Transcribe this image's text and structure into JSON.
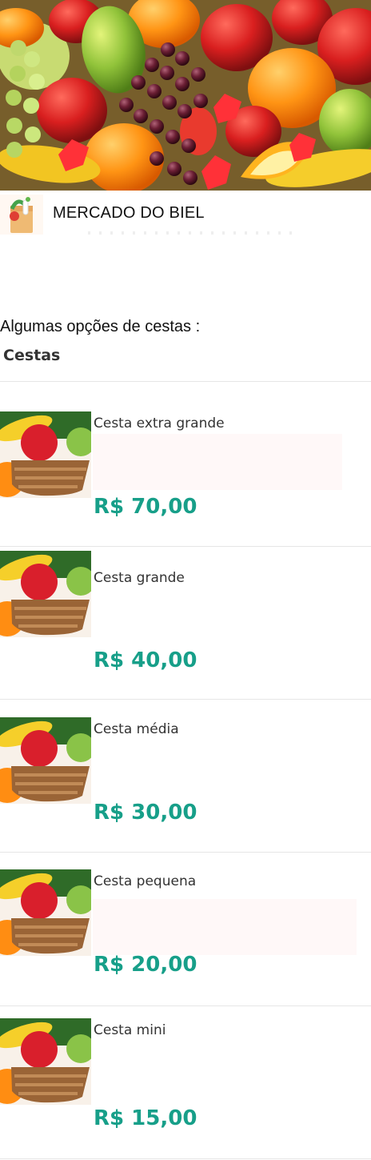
{
  "hero": {
    "image_subject": "mixed fruits banner"
  },
  "store": {
    "name": "MERCADO DO BIEL",
    "logo_icon": "grocery-bag-icon"
  },
  "section": {
    "title": "Algumas opções de cestas :",
    "tab": "Cestas"
  },
  "products": [
    {
      "name": "Cesta extra grande",
      "price": "R$ 70,00",
      "image_icon": "fruit-basket-image"
    },
    {
      "name": "Cesta grande",
      "price": "R$ 40,00",
      "image_icon": "fruit-basket-image"
    },
    {
      "name": "Cesta média",
      "price": "R$ 30,00",
      "image_icon": "fruit-basket-image"
    },
    {
      "name": "Cesta pequena",
      "price": "R$ 20,00",
      "image_icon": "fruit-basket-image"
    },
    {
      "name": "Cesta mini",
      "price": "R$ 15,00",
      "image_icon": "fruit-basket-image"
    }
  ],
  "colors": {
    "price": "#179f89",
    "text": "#111111",
    "divider": "#e6e6e6",
    "description_tint": "#fff8f8"
  }
}
